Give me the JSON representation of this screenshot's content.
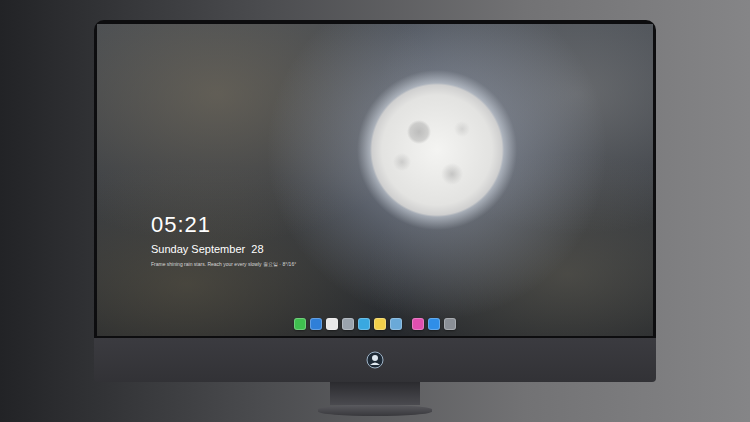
{
  "screen": {
    "time": "05:21",
    "date": "Sunday September  28",
    "info": "Frame shining rain stars. Reach your every slowly 월요일 · 8°/16°"
  },
  "dock": {
    "apps": [
      {
        "color": "#3fbf4f"
      },
      {
        "color": "#2f7fd8"
      },
      {
        "color": "#e8e8e8"
      },
      {
        "color": "#9aa3ad"
      },
      {
        "color": "#39a8e0"
      },
      {
        "color": "#f2d04a"
      },
      {
        "color": "#6aa9d8"
      }
    ],
    "extras": [
      {
        "color": "#e04fb0"
      },
      {
        "color": "#2f8ee8"
      },
      {
        "color": "#8a8f96"
      }
    ]
  }
}
